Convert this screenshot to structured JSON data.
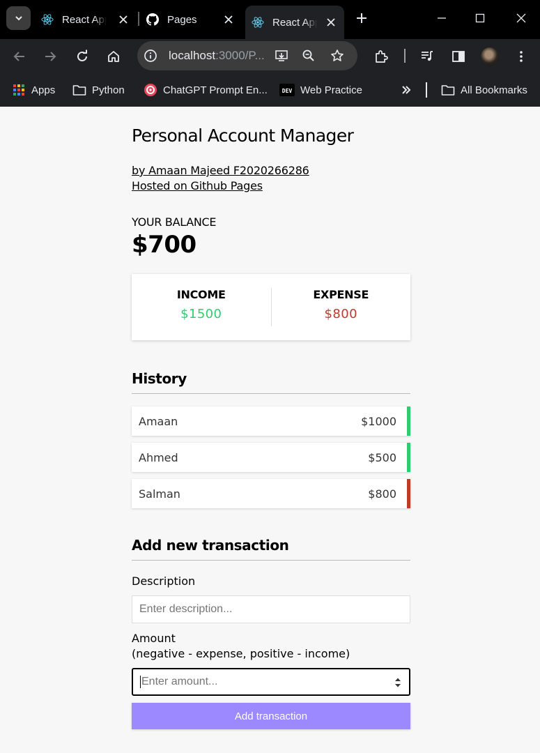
{
  "browser": {
    "tabs": [
      {
        "title": "React App",
        "icon": "react-icon",
        "active": false
      },
      {
        "title": "Pages",
        "icon": "github-icon",
        "active": false
      },
      {
        "title": "React App",
        "icon": "react-icon",
        "active": true
      }
    ],
    "url_host": "localhost",
    "url_path": ":3000/P...",
    "bookmarks": [
      {
        "label": "Apps",
        "icon": "apps-grid-icon"
      },
      {
        "label": "Python",
        "icon": "folder-icon"
      },
      {
        "label": "ChatGPT Prompt En...",
        "icon": "chatgpt-prompt-icon"
      },
      {
        "label": "Web Practice",
        "icon": "dev-icon"
      },
      {
        "label": "All Bookmarks",
        "icon": "folder-icon"
      }
    ],
    "dev_badge": "DEV"
  },
  "app": {
    "title": "Personal Account Manager",
    "author": "by Amaan Majeed F2020266286",
    "hosted": "Hosted on Github Pages",
    "balance_label": "YOUR BALANCE",
    "balance": "$700",
    "income_label": "INCOME",
    "income": "$1500",
    "expense_label": "EXPENSE",
    "expense": "$800",
    "history_title": "History",
    "history": [
      {
        "name": "Amaan",
        "amount": "$1000",
        "type": "plus"
      },
      {
        "name": "Ahmed",
        "amount": "$500",
        "type": "plus"
      },
      {
        "name": "Salman",
        "amount": "$800",
        "type": "minus"
      }
    ],
    "add_title": "Add new transaction",
    "description_label": "Description",
    "description_placeholder": "Enter description...",
    "amount_label": "Amount",
    "amount_hint": "(negative - expense, positive - income)",
    "amount_placeholder": "Enter amount...",
    "submit_label": "Add transaction"
  },
  "colors": {
    "income": "#2ecc71",
    "expense": "#c0392b",
    "button": "#9c88ff"
  }
}
